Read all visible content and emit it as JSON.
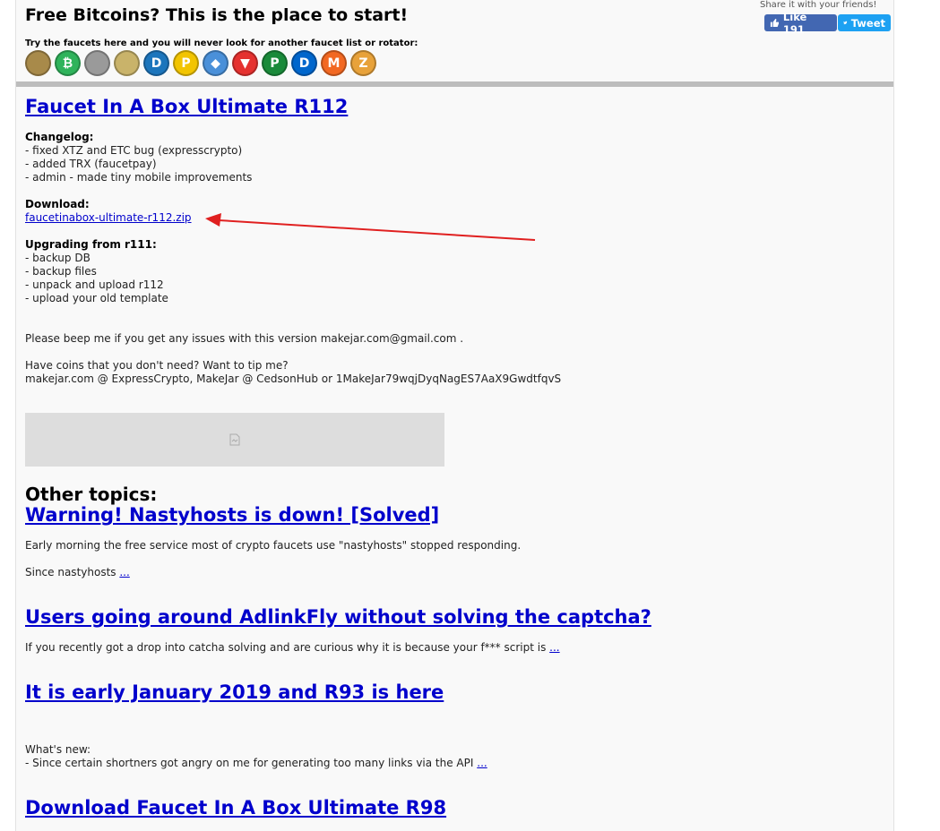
{
  "header": {
    "title": "Free Bitcoins? This is the place to start!",
    "share_label": "Share it with your friends!",
    "like_label": "Like 191",
    "tweet_label": "Tweet",
    "faucet_tagline": "Try the faucets here and you will never look for another faucet list or rotator:"
  },
  "coins": [
    {
      "name": "gold-coin-icon",
      "symbol": "",
      "color": "#a88a4a"
    },
    {
      "name": "bitcoin-cash-icon",
      "symbol": "₿",
      "color": "#2fb35b"
    },
    {
      "name": "grey-coin-icon",
      "symbol": "",
      "color": "#9a9a9a"
    },
    {
      "name": "gold-ring-coin-icon",
      "symbol": "",
      "color": "#c9b36a"
    },
    {
      "name": "dash-icon",
      "symbol": "D",
      "color": "#1c75bc"
    },
    {
      "name": "peercoin-icon",
      "symbol": "P",
      "color": "#f2c400"
    },
    {
      "name": "ethereum-icon",
      "symbol": "◆",
      "color": "#4a90d9"
    },
    {
      "name": "tron-icon",
      "symbol": "▼",
      "color": "#e5312f"
    },
    {
      "name": "peercoin-green-icon",
      "symbol": "P",
      "color": "#1a8a3a"
    },
    {
      "name": "digibyte-icon",
      "symbol": "D",
      "color": "#0066cc"
    },
    {
      "name": "monero-icon",
      "symbol": "M",
      "color": "#f26822"
    },
    {
      "name": "zcash-icon",
      "symbol": "Z",
      "color": "#e8a23a"
    }
  ],
  "article": {
    "title": "Faucet In A Box Ultimate R112",
    "changelog_heading": "Changelog:",
    "changelog": [
      "- fixed XTZ and ETC bug (expresscrypto)",
      "- added TRX (faucetpay)",
      "- admin - made tiny mobile improvements"
    ],
    "download_heading": "Download:",
    "download_link": "faucetinabox-ultimate-r112.zip",
    "upgrade_heading": "Upgrading from r111:",
    "upgrade_steps": [
      "- backup DB",
      "- backup files",
      "- unpack and upload r112",
      "- upload your old template"
    ],
    "contact_line": "Please beep me if you get any issues with this version  makejar.com@gmail.com .",
    "tip_line1": "Have coins that you don't need? Want to tip me?",
    "tip_line2": "makejar.com @ ExpressCrypto, MakeJar @ CedsonHub or 1MakeJar79wqjDyqNagES7AaX9GwdtfqvS"
  },
  "other_topics_heading": "Other topics:",
  "topics": [
    {
      "title": "Warning! Nastyhosts is down! [Solved]",
      "excerpt1": "Early morning the free service most of crypto faucets use \"nastyhosts\" stopped responding.",
      "excerpt2": "Since nastyhosts",
      "more": "..."
    },
    {
      "title": "Users going around AdlinkFly without solving the captcha?",
      "excerpt1": "If you recently got a drop into catcha solving and are curious why it is because your f*** script is",
      "more": "..."
    },
    {
      "title": "It is early January 2019 and R93 is here",
      "excerpt1": "What's new:",
      "excerpt2": "- Since certain shortners got angry on me for generating too many links via the API",
      "more": "..."
    },
    {
      "title": "Download Faucet In A Box Ultimate R98"
    }
  ]
}
